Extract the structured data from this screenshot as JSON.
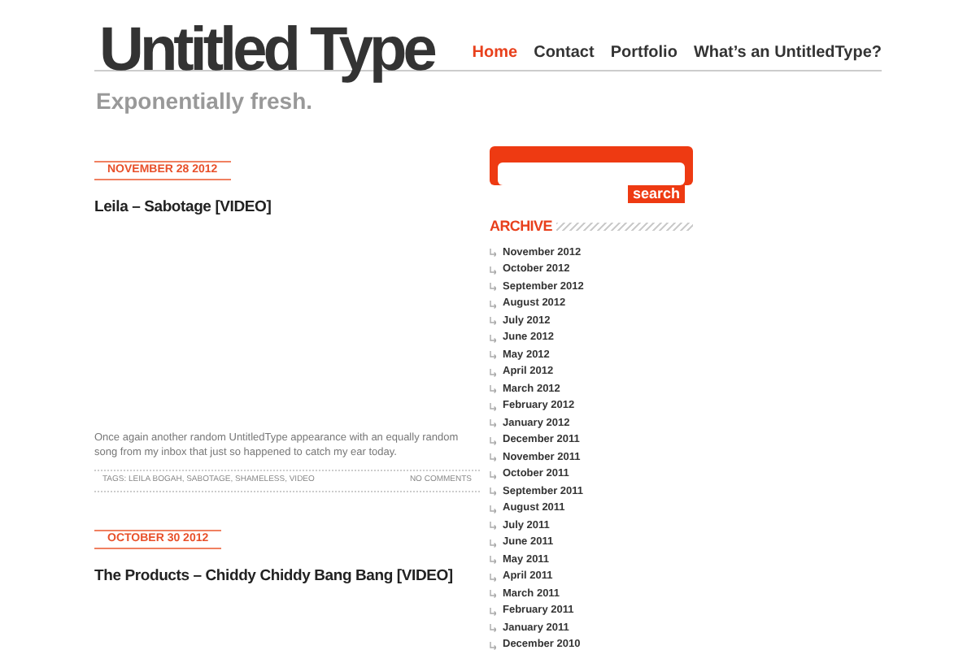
{
  "site": {
    "title": "Untitled Type",
    "tagline": "Exponentially fresh."
  },
  "nav": [
    {
      "label": "Home",
      "selected": true
    },
    {
      "label": "Contact",
      "selected": false
    },
    {
      "label": "Portfolio",
      "selected": false
    },
    {
      "label": "What’s an UntitledType?",
      "selected": false
    }
  ],
  "posts": [
    {
      "date": "NOVEMBER 28 2012",
      "title": "Leila – Sabotage [VIDEO]",
      "excerpt": "Once again another random UntitledType appearance with an equally random song from my inbox that just so happened to catch my ear today.",
      "tags": "TAGS: LEILA BOGAH, SABOTAGE, SHAMELESS, VIDEO",
      "comments": "NO COMMENTS"
    },
    {
      "date": "OCTOBER 30 2012",
      "title": "The Products – Chiddy Chiddy Bang Bang [VIDEO]"
    }
  ],
  "sidebar": {
    "search_button": "search",
    "archive_title": "ARCHIVE",
    "archive": [
      "November 2012",
      "October 2012",
      "September 2012",
      "August 2012",
      "July 2012",
      "June 2012",
      "May 2012",
      "April 2012",
      "March 2012",
      "February 2012",
      "January 2012",
      "December 2011",
      "November 2011",
      "October 2011",
      "September 2011",
      "August 2011",
      "July 2011",
      "June 2011",
      "May 2011",
      "April 2011",
      "March 2011",
      "February 2011",
      "January 2011",
      "December 2010"
    ]
  }
}
